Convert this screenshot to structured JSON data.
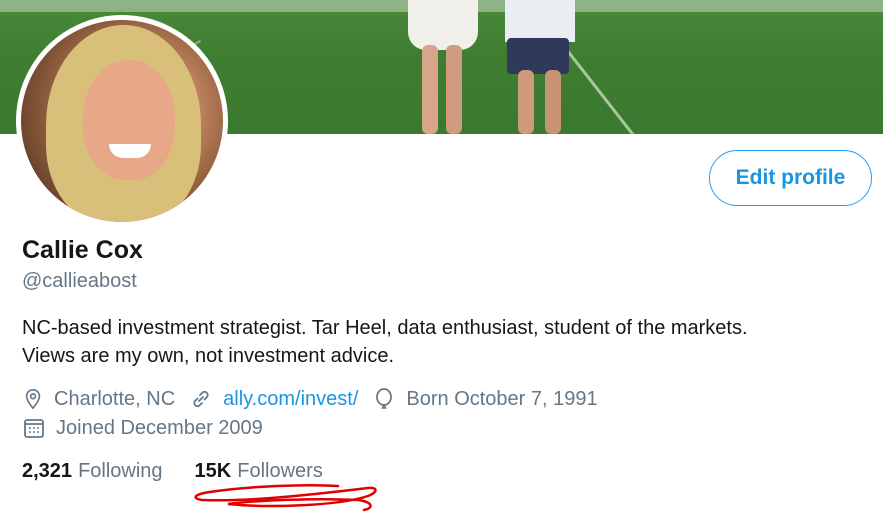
{
  "banner": {},
  "profile": {
    "name": "Callie Cox",
    "handle": "@callieabost",
    "bio_line1": "NC-based investment strategist. Tar Heel, data enthusiast, student of the markets.",
    "bio_line2": "Views are my own, not investment advice.",
    "location": "Charlotte, NC",
    "website": "ally.com/invest/",
    "birthday": "Born October 7, 1991",
    "joined": "Joined December 2009"
  },
  "actions": {
    "edit_profile": "Edit profile"
  },
  "stats": {
    "following_count": "2,321",
    "following_label": "Following",
    "followers_count": "15K",
    "followers_label": "Followers"
  },
  "icons": {
    "location": "location-pin-icon",
    "link": "link-icon",
    "birthday": "balloon-icon",
    "joined": "calendar-icon"
  },
  "colors": {
    "accent": "#1da1f2",
    "link": "#1b95e0",
    "text": "#14171a",
    "muted": "#657786",
    "annotation": "#e00000"
  }
}
